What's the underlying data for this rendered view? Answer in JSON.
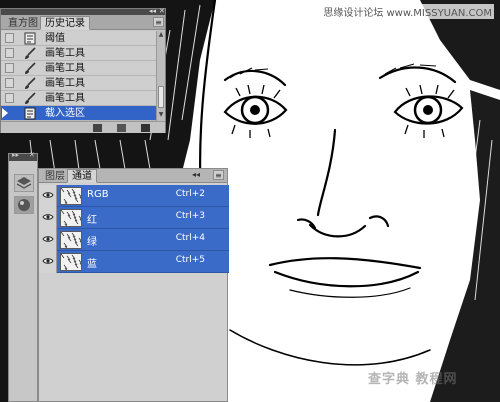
{
  "watermark": {
    "top": "思缘设计论坛 www.MISSYUAN.COM",
    "bottom": "查字典 教程网"
  },
  "history_panel": {
    "tabs": [
      {
        "label": "直方图",
        "active": false
      },
      {
        "label": "历史记录",
        "active": true
      }
    ],
    "items": [
      {
        "label": "阈值",
        "icon": "doc-icon",
        "selected": false
      },
      {
        "label": "画笔工具",
        "icon": "brush-icon",
        "selected": false
      },
      {
        "label": "画笔工具",
        "icon": "brush-icon",
        "selected": false
      },
      {
        "label": "画笔工具",
        "icon": "brush-icon",
        "selected": false
      },
      {
        "label": "画笔工具",
        "icon": "brush-icon",
        "selected": false
      },
      {
        "label": "载入选区",
        "icon": "doc-icon",
        "selected": true
      }
    ]
  },
  "channels_panel": {
    "tabs": [
      {
        "label": "图层",
        "active": false
      },
      {
        "label": "通道",
        "active": true
      }
    ],
    "channels": [
      {
        "name": "RGB",
        "shortcut": "Ctrl+2"
      },
      {
        "name": "红",
        "shortcut": "Ctrl+3"
      },
      {
        "name": "绿",
        "shortcut": "Ctrl+4"
      },
      {
        "name": "蓝",
        "shortcut": "Ctrl+5"
      }
    ]
  },
  "colors": {
    "selection": "#3a6bc9",
    "panel_bg": "#d0d0d0",
    "panel_header": "#4a4a4a"
  }
}
